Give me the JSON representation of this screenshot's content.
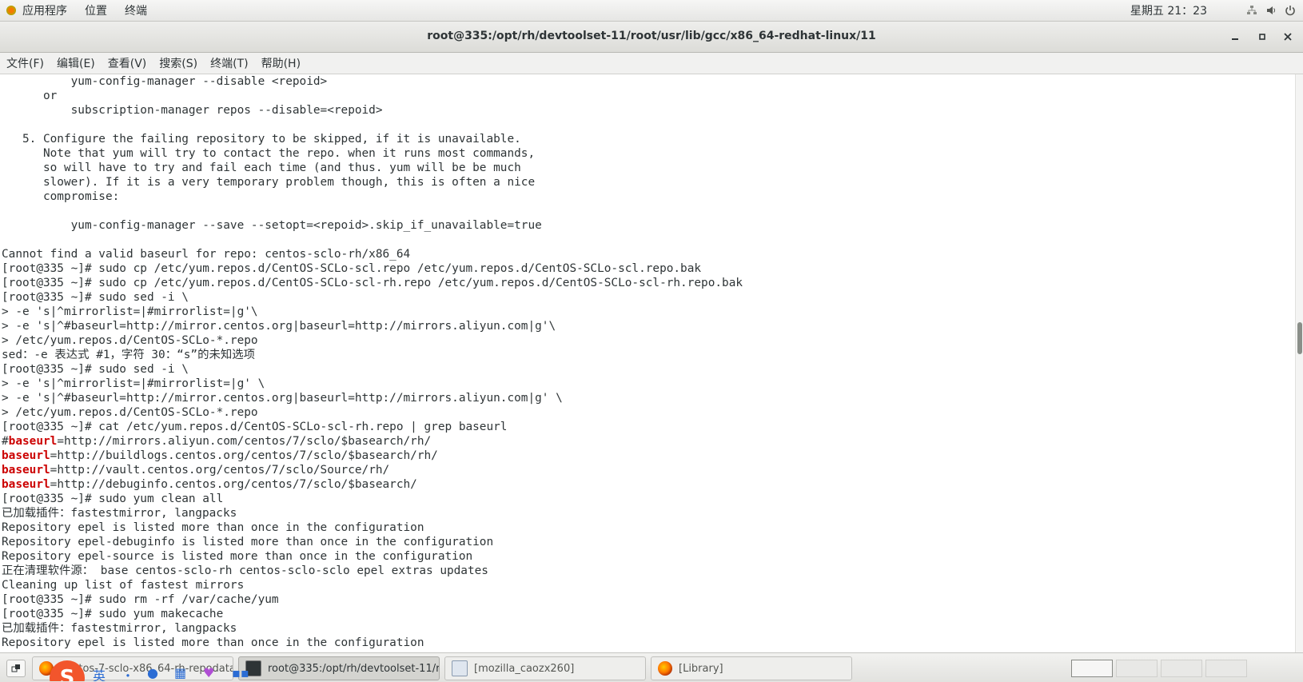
{
  "top_panel": {
    "applications": "应用程序",
    "places": "位置",
    "terminal": "终端",
    "clock": "星期五 21：23"
  },
  "window": {
    "title": "root@335:/opt/rh/devtoolset-11/root/usr/lib/gcc/x86_64-redhat-linux/11"
  },
  "menubar": {
    "file": "文件(F)",
    "edit": "编辑(E)",
    "view": "查看(V)",
    "search": "搜索(S)",
    "terminal": "终端(T)",
    "help": "帮助(H)"
  },
  "terminal": {
    "lines": [
      "          yum-config-manager --disable <repoid>",
      "      or",
      "          subscription-manager repos --disable=<repoid>",
      "",
      "   5. Configure the failing repository to be skipped, if it is unavailable.",
      "      Note that yum will try to contact the repo. when it runs most commands,",
      "      so will have to try and fail each time (and thus. yum will be be much",
      "      slower). If it is a very temporary problem though, this is often a nice",
      "      compromise:",
      "",
      "          yum-config-manager --save --setopt=<repoid>.skip_if_unavailable=true",
      "",
      "Cannot find a valid baseurl for repo: centos-sclo-rh/x86_64",
      "[root@335 ~]# sudo cp /etc/yum.repos.d/CentOS-SCLo-scl.repo /etc/yum.repos.d/CentOS-SCLo-scl.repo.bak",
      "[root@335 ~]# sudo cp /etc/yum.repos.d/CentOS-SCLo-scl-rh.repo /etc/yum.repos.d/CentOS-SCLo-scl-rh.repo.bak",
      "[root@335 ~]# sudo sed -i \\",
      "> -e 's|^mirrorlist=|#mirrorlist=|g'\\",
      "> -e 's|^#baseurl=http://mirror.centos.org|baseurl=http://mirrors.aliyun.com|g'\\",
      "> /etc/yum.repos.d/CentOS-SCLo-*.repo",
      "sed：-e 表达式 #1，字符 30：“s”的未知选项",
      "[root@335 ~]# sudo sed -i \\",
      "> -e 's|^mirrorlist=|#mirrorlist=|g' \\",
      "> -e 's|^#baseurl=http://mirror.centos.org|baseurl=http://mirrors.aliyun.com|g' \\",
      "> /etc/yum.repos.d/CentOS-SCLo-*.repo",
      "[root@335 ~]# cat /etc/yum.repos.d/CentOS-SCLo-scl-rh.repo | grep baseurl",
      "#baseurl=http://mirrors.aliyun.com/centos/7/sclo/$basearch/rh/",
      "baseurl=http://buildlogs.centos.org/centos/7/sclo/$basearch/rh/",
      "baseurl=http://vault.centos.org/centos/7/sclo/Source/rh/",
      "baseurl=http://debuginfo.centos.org/centos/7/sclo/$basearch/",
      "[root@335 ~]# sudo yum clean all",
      "已加载插件：fastestmirror, langpacks",
      "Repository epel is listed more than once in the configuration",
      "Repository epel-debuginfo is listed more than once in the configuration",
      "Repository epel-source is listed more than once in the configuration",
      "正在清理软件源： base centos-sclo-rh centos-sclo-sclo epel extras updates",
      "Cleaning up list of fastest mirrors",
      "[root@335 ~]# sudo rm -rf /var/cache/yum",
      "[root@335 ~]# sudo yum makecache",
      "已加载插件：fastestmirror, langpacks",
      "Repository epel is listed more than once in the configuration"
    ],
    "highlight_word": "baseurl"
  },
  "taskbar": {
    "tasks": [
      {
        "label": "centos-7-sclo-x86_64-rh-repodata",
        "icon": "firefox-icon"
      },
      {
        "label": "root@335:/opt/rh/devtoolset-11/r...",
        "icon": "terminal-icon"
      },
      {
        "label": "[mozilla_caozx260]",
        "icon": "document-icon"
      },
      {
        "label": "[Library]",
        "icon": "firefox-icon"
      }
    ],
    "ime_label": "英"
  }
}
